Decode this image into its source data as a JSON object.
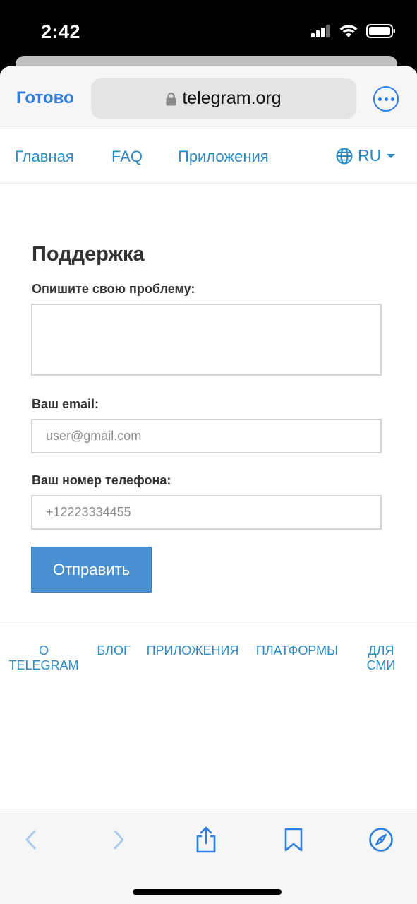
{
  "status_bar": {
    "time": "2:42",
    "icons": [
      "signal-icon",
      "wifi-icon",
      "battery-icon"
    ]
  },
  "browser": {
    "done_label": "Готово",
    "url": "telegram.org",
    "icons": [
      "lock-icon",
      "more-icon"
    ]
  },
  "nav": {
    "links": [
      "Главная",
      "FAQ",
      "Приложения"
    ],
    "language": "RU",
    "icons": [
      "globe-icon",
      "caret-down-icon"
    ]
  },
  "form": {
    "title": "Поддержка",
    "problem_label": "Опишите свою проблему:",
    "problem_value": "",
    "email_label": "Ваш email:",
    "email_placeholder": "user@gmail.com",
    "phone_label": "Ваш номер телефона:",
    "phone_placeholder": "+12223334455",
    "submit_label": "Отправить"
  },
  "footer": {
    "about_line1": "О",
    "about_line2": "TELEGRAM",
    "blog": "БЛОГ",
    "apps": "ПРИЛОЖЕНИЯ",
    "platforms": "ПЛАТФОРМЫ",
    "press_line1": "ДЛЯ",
    "press_line2": "СМИ"
  },
  "toolbar": {
    "icons": [
      "back-icon",
      "forward-icon",
      "share-icon",
      "bookmarks-icon",
      "safari-compass-icon"
    ]
  },
  "colors": {
    "accent": "#2b7de1",
    "link": "#2a8ac6",
    "button": "#4a8fd0"
  }
}
